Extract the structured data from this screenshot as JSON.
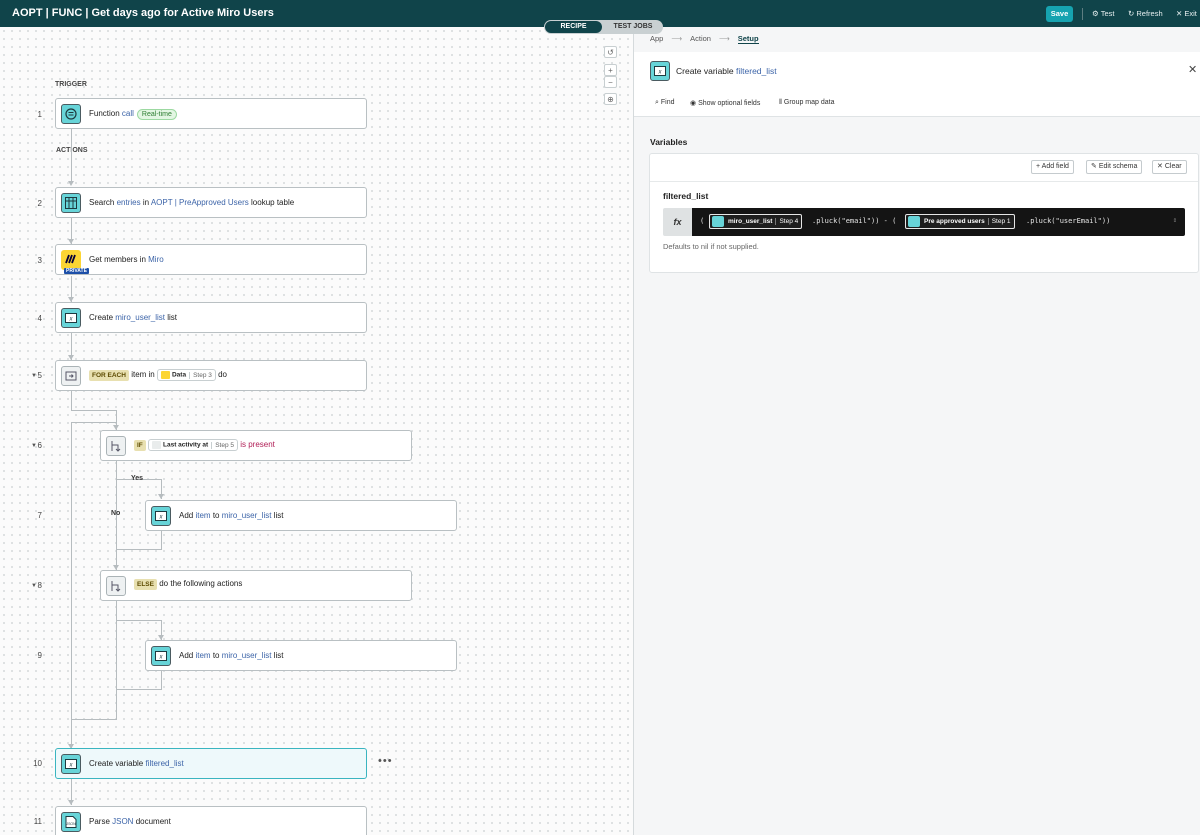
{
  "header": {
    "title": "AOPT | FUNC | Get days ago for Active Miro Users",
    "save": "Save",
    "test": "Test",
    "refresh": "Refresh",
    "exit": "Exit"
  },
  "tabs": [
    "RECIPE",
    "TEST JOBS"
  ],
  "canvas": {
    "trigger_label": "TRIGGER",
    "actions_label": "ACTIONS",
    "yes_label": "Yes",
    "no_label": "No",
    "steps": [
      {
        "num": "1",
        "parts": [
          "Function ",
          "call"
        ],
        "badge": "Real-time"
      },
      {
        "num": "2",
        "parts": [
          "Search ",
          "entries",
          " in ",
          "AOPT | PreApproved Users",
          " lookup table"
        ]
      },
      {
        "num": "3",
        "parts": [
          "Get members in ",
          "Miro"
        ],
        "private": "PRIVATE"
      },
      {
        "num": "4",
        "parts": [
          "Create ",
          "miro_user_list",
          " list"
        ]
      },
      {
        "num": "5",
        "keyword": "FOR EACH",
        "pre": "item in",
        "pill_label": "Data",
        "pill_step": "Step 3",
        "post": "do"
      },
      {
        "num": "6",
        "keyword": "IF",
        "pill_label": "Last activity at",
        "pill_step": "Step 5",
        "post": "is present"
      },
      {
        "num": "7",
        "parts": [
          "Add ",
          "item",
          " to ",
          "miro_user_list",
          " list"
        ]
      },
      {
        "num": "8",
        "keyword": "ELSE",
        "post": "do the following actions"
      },
      {
        "num": "9",
        "parts": [
          "Add ",
          "item",
          " to ",
          "miro_user_list",
          " list"
        ]
      },
      {
        "num": "10",
        "parts": [
          "Create variable ",
          "filtered_list"
        ]
      },
      {
        "num": "11",
        "parts": [
          "Parse ",
          "JSON",
          " document"
        ]
      }
    ]
  },
  "panel": {
    "breadcrumb": [
      "App",
      "Action",
      "Setup"
    ],
    "title_prefix": "Create variable ",
    "title_link": "filtered_list",
    "tools": [
      "Find",
      "Show optional fields",
      "Group map data"
    ],
    "variables_title": "Variables",
    "buttons": [
      "+ Add field",
      "Edit schema",
      "Clear"
    ],
    "field_name": "filtered_list",
    "formula": {
      "pill1_label": "miro_user_list",
      "pill1_step": "Step 4",
      "code1": ".pluck(\"email\")) - (",
      "pill2_label": "Pre approved users",
      "pill2_step": "Step 1",
      "code2": ".pluck(\"userEmail\"))"
    },
    "hint": "Defaults to nil if not supplied."
  }
}
